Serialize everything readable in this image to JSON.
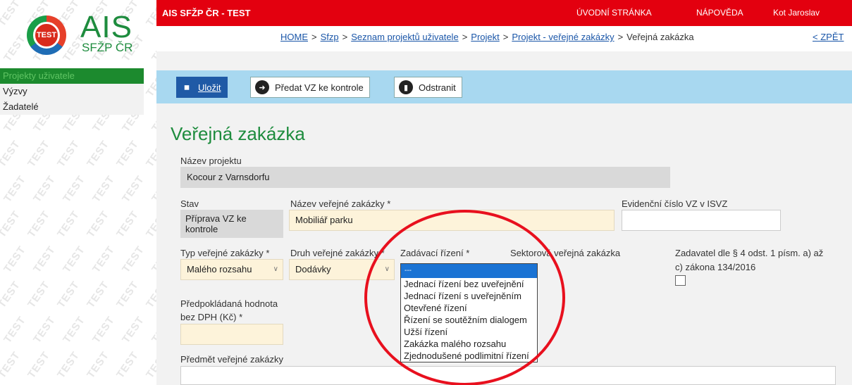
{
  "logo": {
    "badge": "TEST",
    "title": "AIS",
    "subtitle": "SFŽP ČR"
  },
  "watermark": "TEST",
  "sidebar": {
    "items": [
      {
        "label": "Projekty uživatele"
      },
      {
        "label": "Výzvy"
      },
      {
        "label": "Žadatelé"
      }
    ]
  },
  "topbar": {
    "system": "AIS SFŽP ČR - TEST",
    "home": "ÚVODNÍ STRÁNKA",
    "help": "NÁPOVĚDA",
    "user": "Kot Jaroslav"
  },
  "breadcrumb": {
    "items": [
      "HOME",
      "Sfzp",
      "Seznam projektů uživatele",
      "Projekt",
      "Projekt - veřejné zakázky"
    ],
    "current": "Veřejná zakázka",
    "separator": ">",
    "back": "< ZPĚT"
  },
  "toolbar": {
    "save": "Uložit",
    "submit": "Předat VZ ke kontrole",
    "delete": "Odstranit"
  },
  "page": {
    "title": "Veřejná zakázka"
  },
  "form": {
    "project_name": {
      "label": "Název projektu",
      "value": "Kocour z Varnsdorfu"
    },
    "status": {
      "label": "Stav",
      "value": "Příprava VZ ke kontrole"
    },
    "contract_name": {
      "label": "Název veřejné zakázky *",
      "value": "Mobiliář parku"
    },
    "isvz_number": {
      "label": "Evidenční číslo VZ v ISVZ",
      "value": ""
    },
    "contract_type": {
      "label": "Typ veřejné zakázky *",
      "value": "Malého rozsahu"
    },
    "contract_kind": {
      "label": "Druh veřejné zakázky *",
      "value": "Dodávky"
    },
    "procedure": {
      "label": "Zadávací řízení *",
      "options": [
        "---",
        "Jednací řízení bez uveřejnění",
        "Jednací řízení s uveřejněním",
        "Otevřené řízení",
        "Řízení se soutěžním dialogem",
        "Užší řízení",
        "Zakázka malého rozsahu",
        "Zjednodušené podlimitní řízení"
      ]
    },
    "sector": {
      "label": "Sektorová veřejná zakázka"
    },
    "contracting_authority": {
      "label_1": "Zadavatel dle § 4 odst. 1 písm. a) až",
      "label_2": "c) zákona 134/2016"
    },
    "estimated_value": {
      "label_1": "Předpokládaná hodnota",
      "label_2": "bez DPH (Kč) *",
      "value": ""
    },
    "subject": {
      "label": "Předmět veřejné zakázky",
      "value": ""
    }
  },
  "colors": {
    "brand_red": "#e3000f",
    "brand_green": "#1e8c3e",
    "toolbar": "#a8d8f0",
    "annotation": "#e8101e"
  }
}
